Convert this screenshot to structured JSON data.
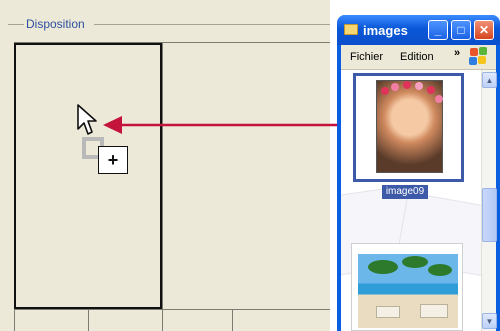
{
  "disposition": {
    "label": "Disposition"
  },
  "window": {
    "title": "images",
    "buttons": {
      "minimize": "_",
      "maximize": "□",
      "close": "✕"
    },
    "menu": {
      "items": [
        "Fichier",
        "Edition"
      ],
      "overflow": "»"
    },
    "thumbnails": [
      {
        "label": "image09",
        "selected": true
      },
      {
        "label": "",
        "selected": false
      }
    ],
    "scrollbar": {
      "up": "▲",
      "down": "▼"
    }
  },
  "drop_indicator": {
    "plus": "+"
  },
  "colors": {
    "panel": "#ece9d8",
    "group_label": "#2f4f9f",
    "drag_arrow": "#c4143c",
    "selection": "#3c5aa8",
    "titlebar": "#0a57d8"
  },
  "icons": [
    "arrow-cursor-icon",
    "folder-icon",
    "windows-logo-icon",
    "plus-icon"
  ]
}
